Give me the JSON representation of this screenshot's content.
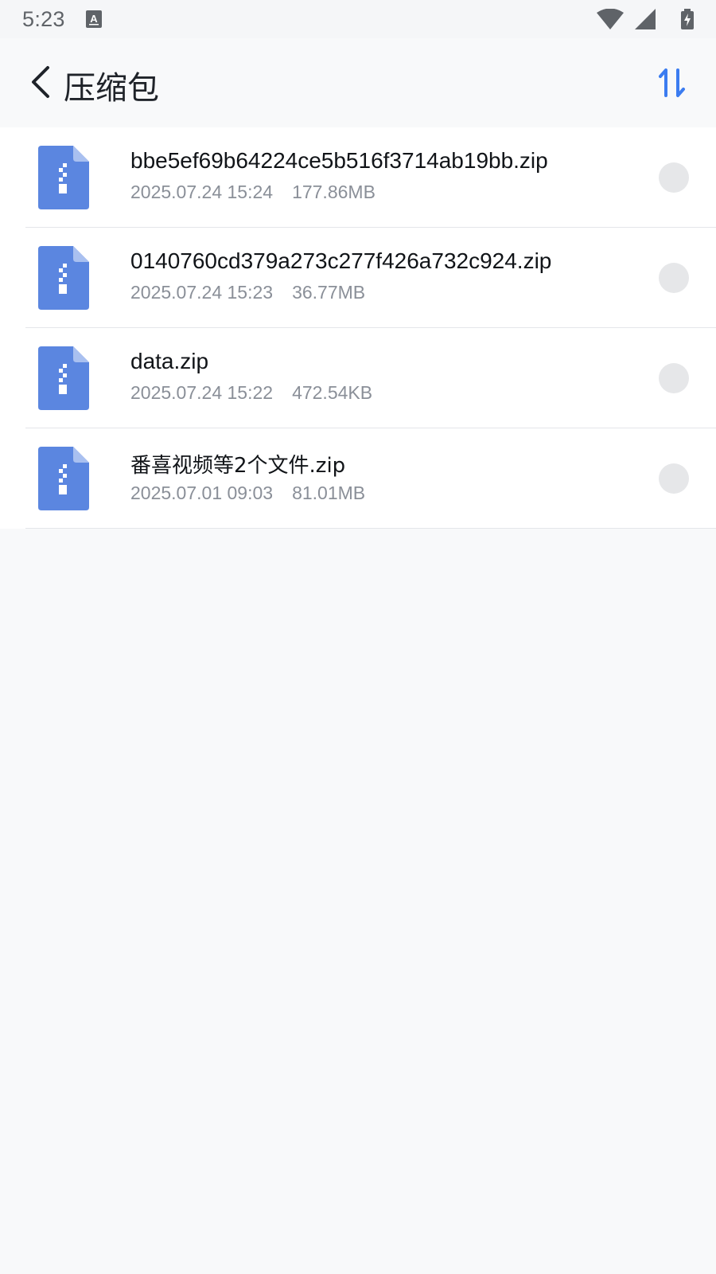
{
  "status_bar": {
    "time": "5:23",
    "icons": [
      "text-input-icon",
      "wifi-icon",
      "signal-icon",
      "battery-charging-icon"
    ]
  },
  "header": {
    "title": "压缩包",
    "back_icon": "chevron-left-icon",
    "sort_icon": "sort-icon",
    "accent_color": "#3b7cf0"
  },
  "files": [
    {
      "name": "bbe5ef69b64224ce5b516f3714ab19bb.zip",
      "date": "2025.07.24 15:24",
      "size": "177.86MB",
      "selected": false
    },
    {
      "name": "0140760cd379a273c277f426a732c924.zip",
      "date": "2025.07.24 15:23",
      "size": "36.77MB",
      "selected": false
    },
    {
      "name": "data.zip",
      "date": "2025.07.24 15:22",
      "size": "472.54KB",
      "selected": false
    },
    {
      "name": "番喜视频等2个文件.zip",
      "date": "2025.07.01 09:03",
      "size": "81.01MB",
      "selected": false
    }
  ],
  "colors": {
    "zip_icon": "#5b86e0",
    "zip_icon_fold": "#a9c0f0",
    "radio": "#e6e7e9",
    "meta_text": "#8a8f98"
  }
}
